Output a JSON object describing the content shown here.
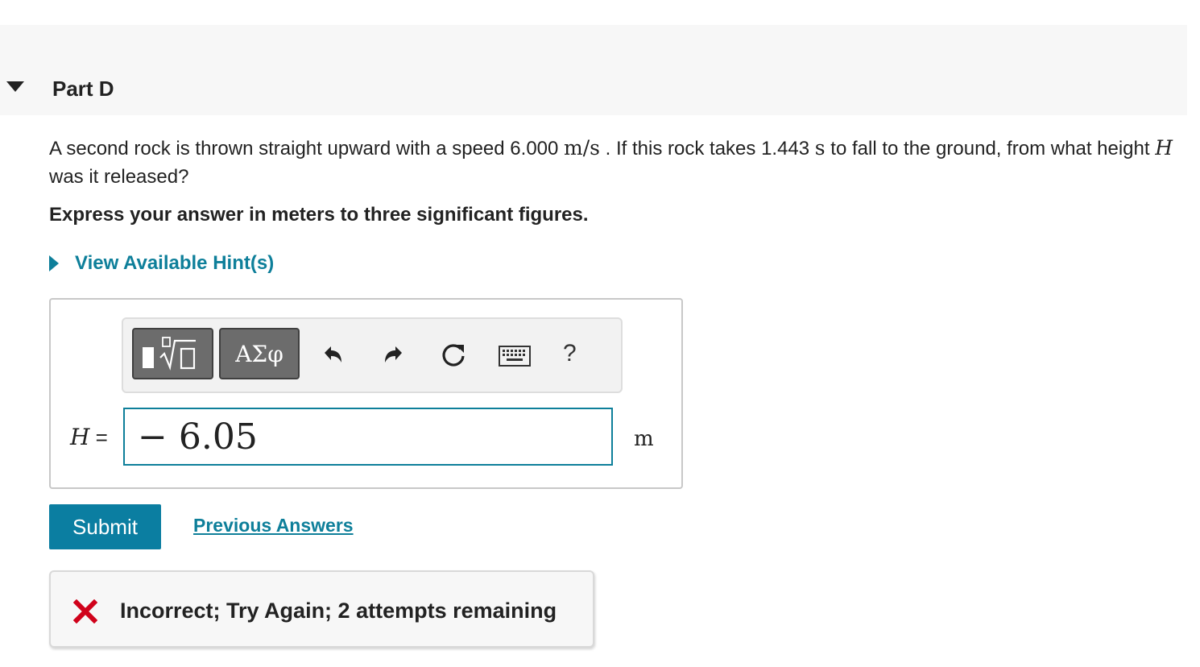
{
  "part": {
    "title": "Part D"
  },
  "question": {
    "text_1": "A second rock is thrown straight upward with a speed 6.000 ",
    "unit_speed": "m/s",
    "text_2": " . If this rock takes 1.443 ",
    "unit_time": "s",
    "text_3": " to fall to the ground, from what height ",
    "var": "H",
    "text_4": " was it released?"
  },
  "instruction": "Express your answer in meters to three significant figures.",
  "hints": {
    "label": "View Available Hint(s)"
  },
  "toolbar": {
    "greek_label": "ΑΣφ",
    "help_label": "?",
    "icons": [
      "templates-icon",
      "undo-icon",
      "redo-icon",
      "reset-icon",
      "keyboard-icon"
    ]
  },
  "answer": {
    "var": "H",
    "equals": " =",
    "value": "− 6.05",
    "unit": "m"
  },
  "actions": {
    "submit_label": "Submit",
    "previous_label": "Previous Answers"
  },
  "feedback": {
    "text": "Incorrect; Try Again; 2 attempts remaining",
    "status_color": "#d0021b"
  },
  "colors": {
    "accent": "#0e7f9a",
    "submit": "#0b7ea1",
    "error": "#d0021b"
  }
}
